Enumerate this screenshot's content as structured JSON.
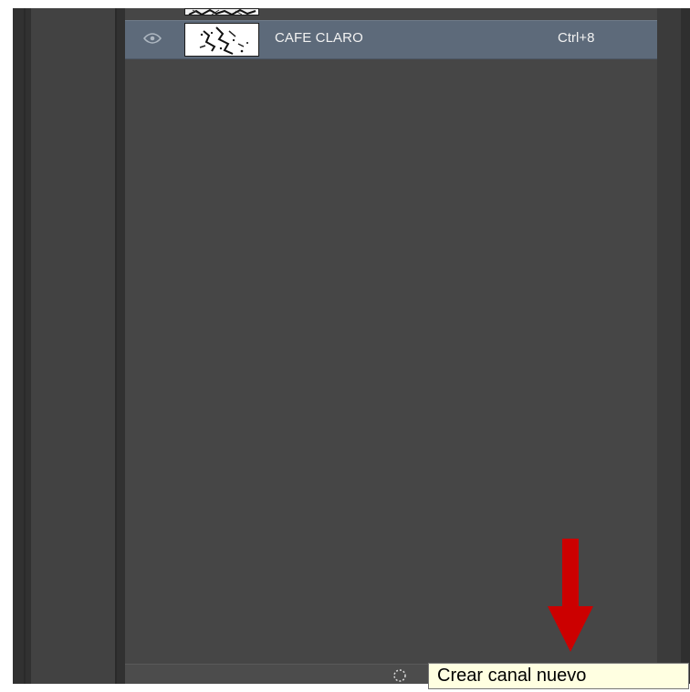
{
  "panel": {
    "channels": [
      {
        "name": "CAFE CLARO",
        "shortcut": "Ctrl+8",
        "visible": true,
        "selected": true
      }
    ],
    "footer": {
      "icon": "selection-icon",
      "tooltip": "Crear canal nuevo"
    }
  },
  "annotation": {
    "arrow_icon": "arrow-down-icon",
    "arrow_color": "#cc0000"
  },
  "colors": {
    "panel_background": "#464646",
    "selected_row": "#5d6a7a",
    "tooltip_background": "#ffffe1"
  }
}
